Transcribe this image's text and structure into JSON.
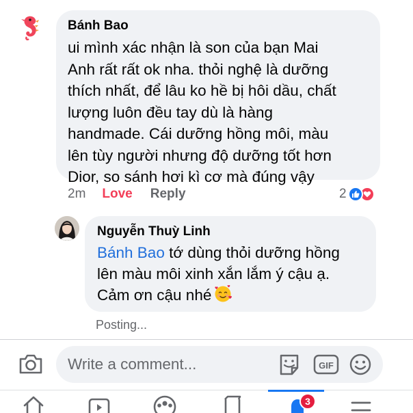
{
  "comments": [
    {
      "author": "Bánh Bao",
      "lines": [
        "ui mình xác nhận là son của bạn Mai",
        "Anh rất rất ok nha. thỏi nghệ là dưỡng",
        "thích nhất, để lâu ko hề bị hôi dầu, chất",
        "lượng luôn đều tay dù là hàng",
        "handmade. Cái dưỡng hồng môi, màu",
        "lên tùy người nhưng độ dưỡng tốt hơn",
        "Dior, so sánh hơi kì cơ mà đúng vậy"
      ],
      "time": "2m",
      "love_label": "Love",
      "reply_label": "Reply",
      "reaction_count": "2",
      "reactions": [
        "like-icon",
        "love-icon"
      ]
    }
  ],
  "reply": {
    "author": "Nguyễn Thuỳ Linh",
    "mention": "Bánh Bao",
    "line1_rest": " tớ dùng thỏi dưỡng hồng",
    "line2": "lên màu môi xinh xắn lắm ý cậu ạ.",
    "line3": "Cảm ơn cậu nhé",
    "emoji": "smiling-face-with-hearts-icon",
    "status": "Posting..."
  },
  "composer": {
    "placeholder": "Write a comment...",
    "gif_label": "GIF"
  },
  "nav": {
    "items": [
      "home-icon",
      "watch-icon",
      "groups-icon",
      "marketplace-icon",
      "notifications-icon",
      "menu-icon"
    ],
    "active": "notifications-icon",
    "notification_badge": "3"
  },
  "colors": {
    "bubble": "#f0f2f5",
    "mention": "#216fdb",
    "love": "#f33e58",
    "like": "#1877f2",
    "secondary_text": "#65676b",
    "badge": "#e41e3f"
  }
}
